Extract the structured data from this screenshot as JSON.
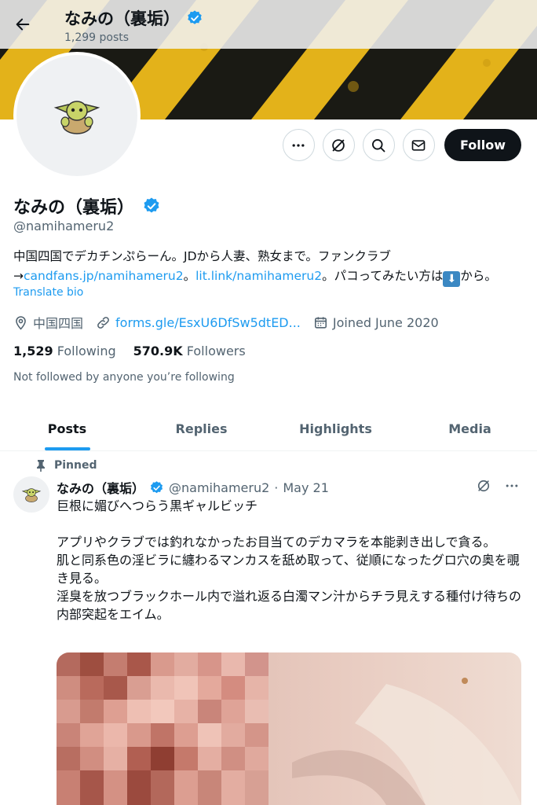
{
  "header": {
    "title": "なみの（裏垢）",
    "post_count": "1,299 posts"
  },
  "profile": {
    "display_name": "なみの（裏垢）",
    "handle": "@namihameru2",
    "bio": {
      "part1": "中国四国でデカチンぷらーん。JDから人妻、熟女まで。ファンクラブ→",
      "link1": "candfans.jp/namihameru2",
      "part2": "。",
      "link2": "lit.link/namihameru2",
      "part3": "。パコってみたい方は",
      "emoji": "⬇",
      "part4": "から。"
    },
    "translate_label": "Translate bio",
    "location": "中国四国",
    "website": "forms.gle/EsxU6DfSw5dtED...",
    "joined": "Joined June 2020",
    "following_count": "1,529",
    "following_label": "Following",
    "followers_count": "570.9K",
    "followers_label": "Followers",
    "not_followed": "Not followed by anyone you’re following"
  },
  "actions": {
    "follow_label": "Follow"
  },
  "tabs": [
    {
      "label": "Posts"
    },
    {
      "label": "Replies"
    },
    {
      "label": "Highlights"
    },
    {
      "label": "Media"
    }
  ],
  "post": {
    "pinned_label": "Pinned",
    "author_name": "なみの（裏垢）",
    "author_handle": "@namihameru2",
    "separator": "·",
    "date": "May 21",
    "line1": "巨根に媚びへつらう黒ギャルビッチ",
    "line2": "アプリやクラブでは釣れなかったお目当てのデカマラを本能剥き出しで貪る。",
    "line3": "肌と同系色の淫ビラに纏わるマンカスを舐め取って、従順になったグロ穴の奥を覗き見る。",
    "line4": "淫臭を放つブラックホール内で溢れ返る白濁マン汁からチラ見えする種付け待ちの内部突起をエイム。"
  },
  "colors": {
    "accent": "#1d9bf0",
    "text": "#0f1419",
    "muted": "#536471",
    "verified": "#1d9bf0",
    "banner_yellow": "#e9b91c",
    "banner_dark": "#1a1a14"
  },
  "icons": [
    "back-arrow-icon",
    "verified-badge-icon",
    "more-icon",
    "grok-icon",
    "search-icon",
    "mail-icon",
    "location-icon",
    "link-icon",
    "calendar-icon",
    "pin-icon"
  ]
}
